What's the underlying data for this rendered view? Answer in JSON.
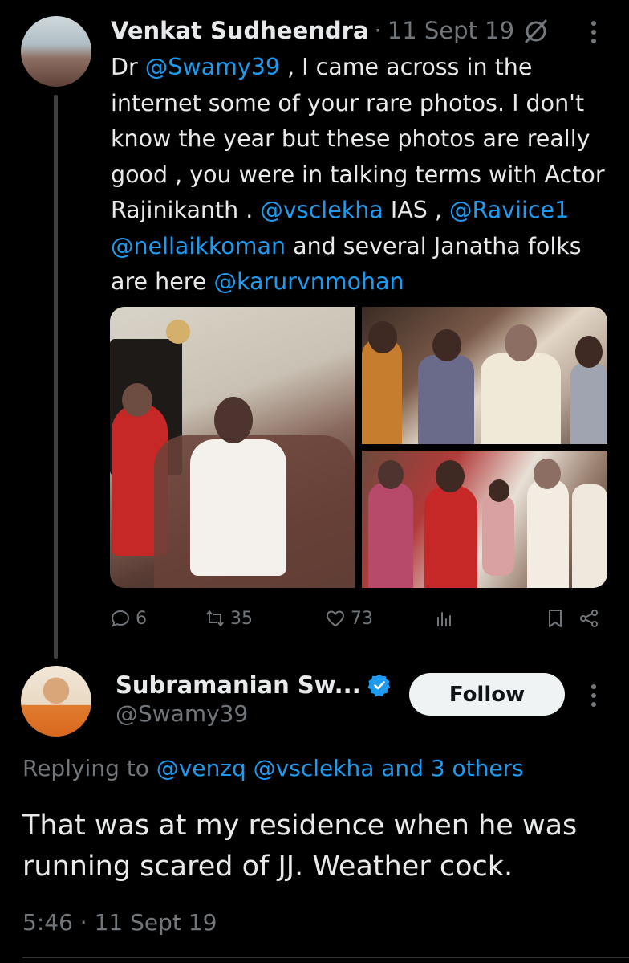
{
  "tweet1": {
    "author_name": "Venkat Sudheendra",
    "separator": "·",
    "date": "11 Sept 19",
    "text_parts": [
      {
        "t": "Dr ",
        "link": false
      },
      {
        "t": "@Swamy39",
        "link": true
      },
      {
        "t": " , I came across in the internet some of your rare photos. I don't know the year but these photos are really good , you were in talking terms with Actor Rajinikanth . ",
        "link": false
      },
      {
        "t": "@vsclekha",
        "link": true
      },
      {
        "t": " IAS , ",
        "link": false
      },
      {
        "t": "@Raviice1",
        "link": true
      },
      {
        "t": " ",
        "link": false
      },
      {
        "t": "@nellaikkoman",
        "link": true
      },
      {
        "t": " and several Janatha folks are here ",
        "link": false
      },
      {
        "t": "@karurvnmohan",
        "link": true
      }
    ],
    "actions": {
      "replies": "6",
      "retweets": "35",
      "likes": "73"
    }
  },
  "tweet2": {
    "author_name": "Subramanian Sw...",
    "handle": "@Swamy39",
    "follow_label": "Follow",
    "replying_prefix": "Replying to ",
    "replying_users": "@venzq @vsclekha and 3 others",
    "text": "That was at my residence when he was running scared of JJ. Weather cock.",
    "timestamp": "5:46 · 11 Sept 19"
  },
  "colors": {
    "background": "#000000",
    "text": "#e7e9ea",
    "muted": "#71767b",
    "link": "#1d9bf0",
    "verified": "#1d9bf0"
  },
  "icons": [
    "muted-icon",
    "more-icon",
    "reply-icon",
    "retweet-icon",
    "like-icon",
    "views-icon",
    "bookmark-icon",
    "share-icon",
    "verified-badge-icon"
  ]
}
